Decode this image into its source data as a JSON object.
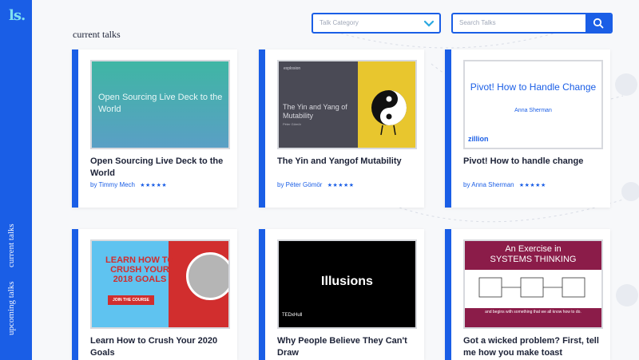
{
  "app": {
    "logo": "ls."
  },
  "sidebar": {
    "tabs": [
      {
        "label": "current talks"
      },
      {
        "label": "upcoming talks"
      }
    ]
  },
  "header": {
    "title": "current talks",
    "category_placeholder": "Talk Category",
    "search_placeholder": "Search Talks"
  },
  "cards": [
    {
      "title": "Open Sourcing Live Deck to the World",
      "author": "by Timmy Mech",
      "rating": 5,
      "stars": "★★★★★",
      "thumb_text": "Open Sourcing Live Deck to the World"
    },
    {
      "title": "The Yin and Yangof Mutability",
      "author": "by Péter Gömör",
      "rating": 5,
      "stars": "★★★★★",
      "thumb_text": "The Yin and Yang of Mutability",
      "thumb_brand": "explosion",
      "thumb_sub": "Péter Gömör"
    },
    {
      "title": "Pivot! How to handle change",
      "author": "by Anna Sherman",
      "rating": 5,
      "stars": "★★★★★",
      "thumb_text": "Pivot! How to Handle Change",
      "thumb_by": "Anna Sherman",
      "thumb_logo": "zillion"
    },
    {
      "title": "Learn How to Crush Your 2020 Goals",
      "thumb_text": "LEARN HOW TO CRUSH YOUR 2018 GOALS",
      "thumb_cta": "JOIN THE COURSE"
    },
    {
      "title": "Why People Believe They Can't Draw",
      "thumb_text": "Illusions",
      "thumb_tag": "TEDxHull"
    },
    {
      "title": "Got a wicked problem? First, tell me how you make toast",
      "thumb_line1": "An Exercise in",
      "thumb_line2": "SYSTEMS THINKING",
      "thumb_caption": "and begins with something that we all know how to do."
    }
  ],
  "colors": {
    "accent": "#1a5ee6",
    "logo": "#7fe0f0",
    "text": "#1c2237"
  }
}
